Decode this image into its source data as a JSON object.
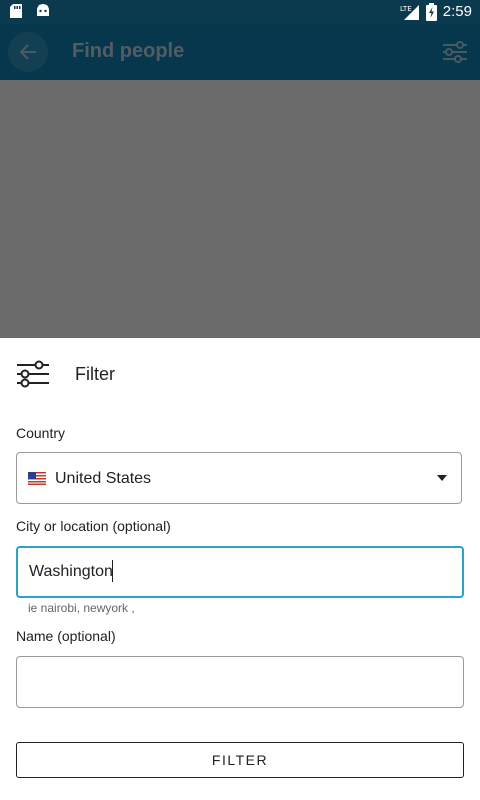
{
  "status_bar": {
    "time": "2:59",
    "network": "LTE",
    "left_icons": [
      "sd-card-icon",
      "android-icon"
    ],
    "right_icons": [
      "lte-signal-icon",
      "battery-charging-icon"
    ]
  },
  "app_bar": {
    "title": "Find people",
    "background": "#0b5575",
    "icons": [
      "back-arrow-icon",
      "filter-sliders-icon"
    ]
  },
  "sheet": {
    "header_title": "Filter",
    "country": {
      "label": "Country",
      "selected": "United States",
      "flag": "us-flag-icon"
    },
    "city": {
      "label": "City or location (optional)",
      "value": "Washington",
      "helper": "ie nairobi, newyork ,",
      "focus_color": "#2aa3c6"
    },
    "name": {
      "label": "Name (optional)",
      "value": ""
    },
    "filter_button_label": "FILTER"
  }
}
